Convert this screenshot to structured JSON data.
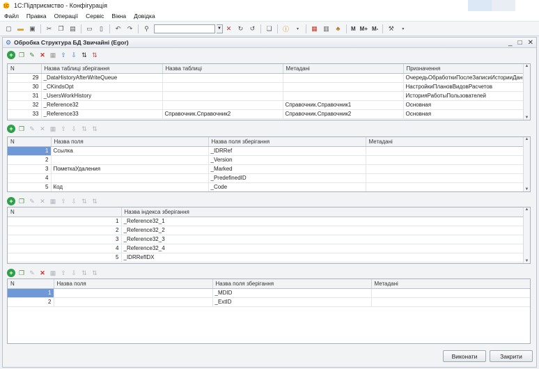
{
  "app": {
    "title": "1С:Підприємство - Конфігурація"
  },
  "menu": [
    {
      "label": "Файл",
      "name": "menu-file"
    },
    {
      "label": "Правка",
      "name": "menu-edit"
    },
    {
      "label": "Операції",
      "name": "menu-operations"
    },
    {
      "label": "Сервіс",
      "name": "menu-service"
    },
    {
      "label": "Вікна",
      "name": "menu-windows"
    },
    {
      "label": "Довідка",
      "name": "menu-help"
    }
  ],
  "toolbar": {
    "search_value": "",
    "m_label": "M",
    "mplus_label": "M+",
    "mminus_label": "M-"
  },
  "window": {
    "title": "Обробка  Структура БД Звичайні (Egor)"
  },
  "tables_grid": {
    "columns": [
      "N",
      "Назва таблиці зберігання",
      "Назва таблиці",
      "Метадані",
      "Призначення"
    ],
    "rows": [
      [
        "29",
        "_DataHistoryAfterWriteQueue",
        "",
        "",
        "ОчередьОбработкиПослеЗаписиИсторииДан..."
      ],
      [
        "30",
        "_CKindsOpt",
        "",
        "",
        "НастройкиПлановВидовРасчетов"
      ],
      [
        "31",
        "_UsersWorkHistory",
        "",
        "",
        "ИсторияРаботыПользователей"
      ],
      [
        "32",
        "_Reference32",
        "Справочник.Справочник1",
        "Справочник.Справочник1",
        "Основная"
      ],
      [
        "33",
        "_Reference33",
        "Справочник.Справочник2",
        "Справочник.Справочник2",
        "Основная"
      ]
    ]
  },
  "fields_grid": {
    "columns": [
      "N",
      "Назва поля",
      "Назва поля зберігання",
      "Метадані"
    ],
    "rows": [
      [
        "1",
        "Ссылка",
        "_IDRRef",
        ""
      ],
      [
        "2",
        "",
        "_Version",
        ""
      ],
      [
        "3",
        "ПометкаУдаления",
        "_Marked",
        ""
      ],
      [
        "4",
        "",
        "_PredefinedID",
        ""
      ],
      [
        "5",
        "Код",
        "_Code",
        ""
      ]
    ]
  },
  "indexes_grid": {
    "columns": [
      "N",
      "Назва індекса зберігання"
    ],
    "rows": [
      [
        "1",
        "_Reference32_1"
      ],
      [
        "2",
        "_Reference32_2"
      ],
      [
        "3",
        "_Reference32_3"
      ],
      [
        "4",
        "_Reference32_4"
      ],
      [
        "5",
        "_IDRRefIDX"
      ]
    ]
  },
  "index_fields_grid": {
    "columns": [
      "N",
      "Назва поля",
      "Назва поля зберігання",
      "Метадані"
    ],
    "rows": [
      [
        "1",
        "",
        "_MDID",
        ""
      ],
      [
        "2",
        "",
        "_ExtID",
        ""
      ]
    ]
  },
  "buttons": {
    "run": "Виконати",
    "close": "Закрити"
  },
  "colors": {
    "selection": "#4c77c6",
    "add_icon": "#2fa04a",
    "delete_icon": "#cc2a2a"
  }
}
